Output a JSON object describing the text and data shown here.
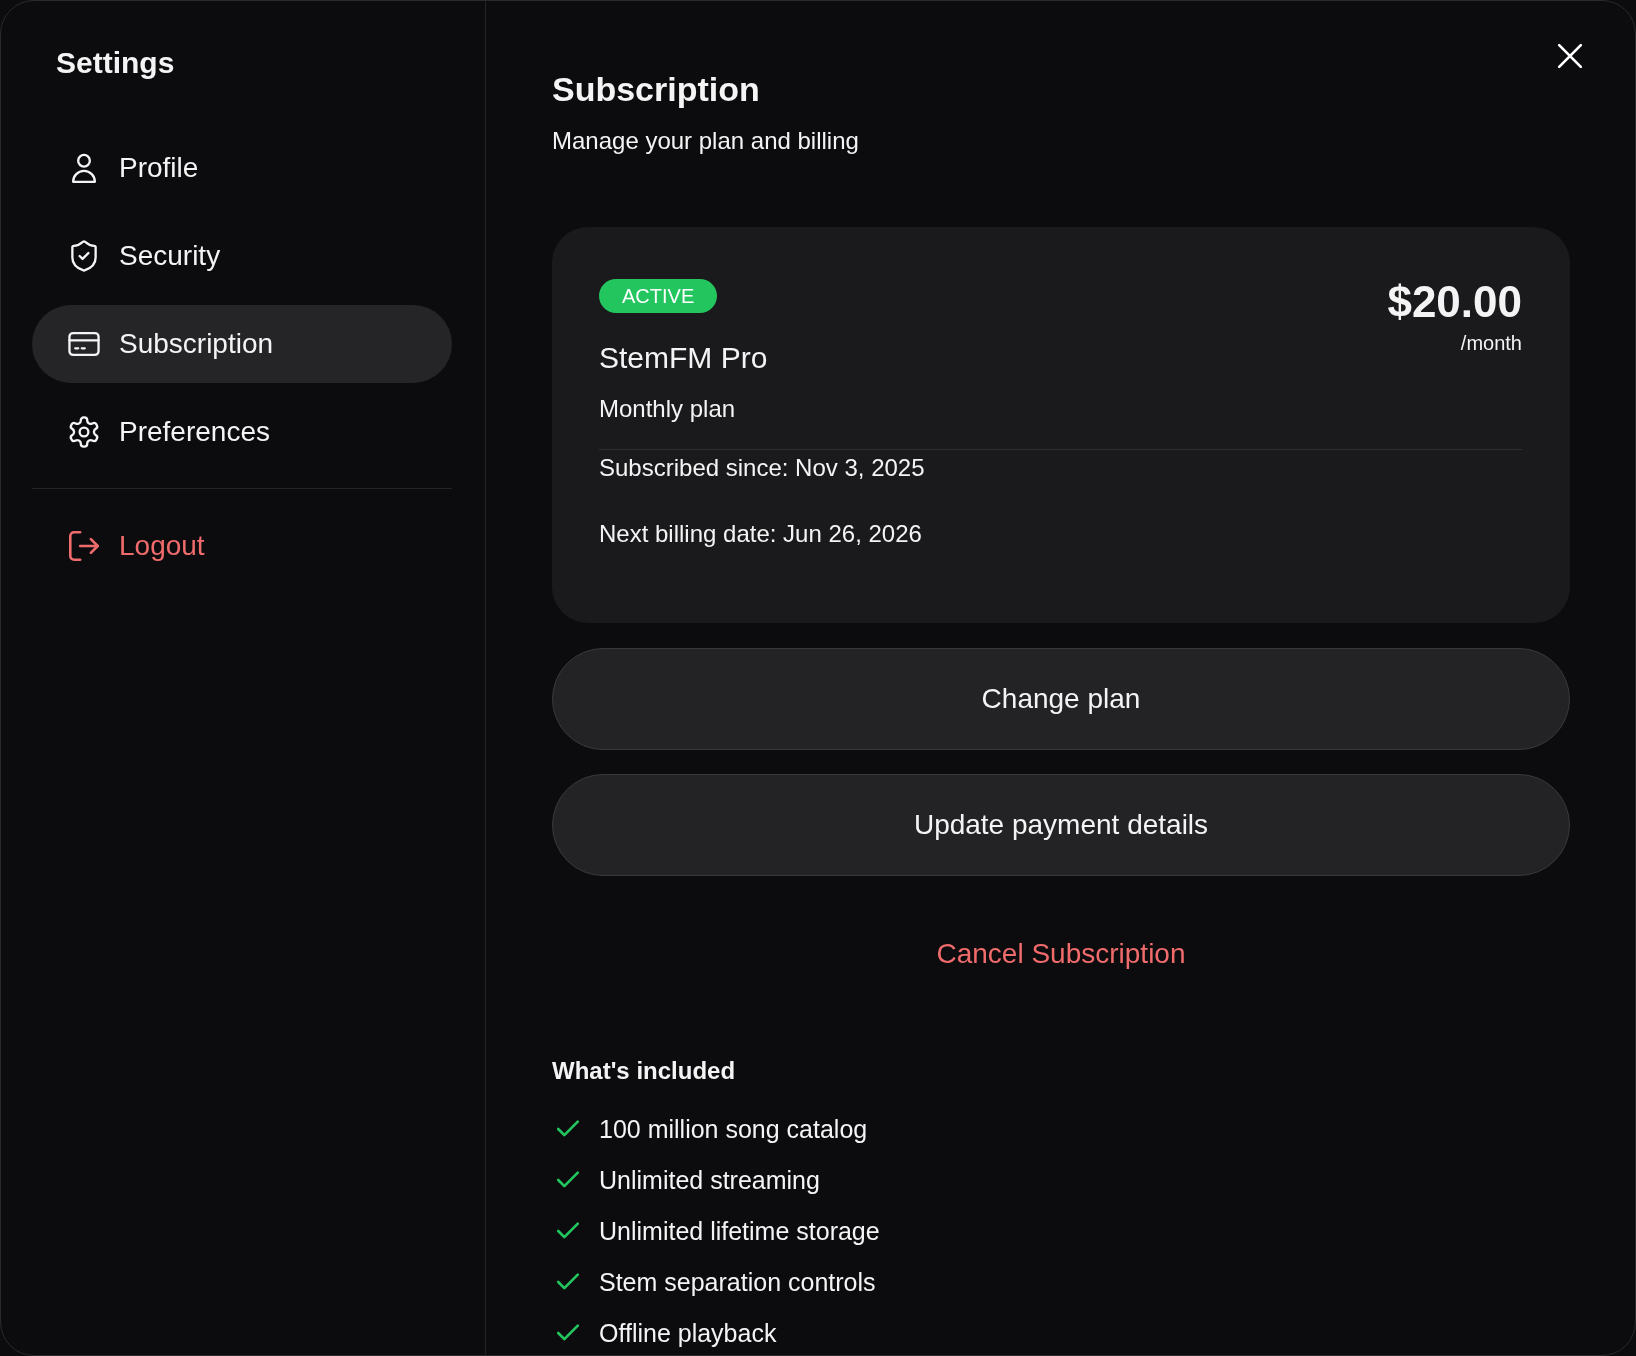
{
  "sidebar": {
    "title": "Settings",
    "items": [
      {
        "label": "Profile",
        "selected": false
      },
      {
        "label": "Security",
        "selected": false
      },
      {
        "label": "Subscription",
        "selected": true
      },
      {
        "label": "Preferences",
        "selected": false
      }
    ],
    "logout": "Logout"
  },
  "header": {
    "title": "Subscription",
    "subtitle": "Manage your plan and billing"
  },
  "plan_card": {
    "status": "ACTIVE",
    "name": "StemFM Pro",
    "billing_cycle": "Monthly plan",
    "price": "$20.00",
    "period": "/month",
    "details": [
      "Subscribed since: Nov 3, 2025",
      "Next billing date: Jun 26, 2026"
    ]
  },
  "buttons": [
    "Change plan",
    "Update payment details"
  ],
  "cancel_link": "Cancel Subscription",
  "included": {
    "title": "What's included",
    "items": [
      "100 million song catalog",
      "Unlimited streaming",
      "Unlimited lifetime storage",
      "Stem separation controls",
      "Offline playback"
    ]
  }
}
